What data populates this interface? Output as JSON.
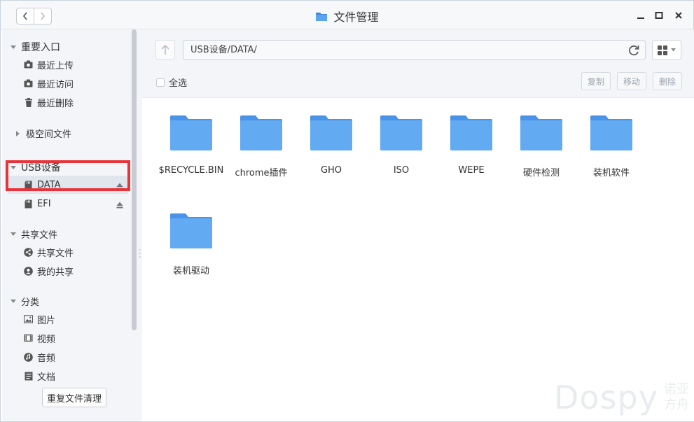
{
  "window": {
    "title": "文件管理"
  },
  "sidebar": {
    "sections": [
      {
        "label": "重要入口",
        "items": [
          {
            "label": "最近上传",
            "icon": "camera-icon"
          },
          {
            "label": "最近访问",
            "icon": "camera-icon"
          },
          {
            "label": "最近删除",
            "icon": "trash-icon"
          }
        ]
      },
      {
        "label": "极空间文件",
        "items": []
      },
      {
        "label": "USB设备",
        "items": [
          {
            "label": "DATA",
            "icon": "sd-card-icon",
            "selected": true
          },
          {
            "label": "EFI",
            "icon": "sd-card-icon"
          }
        ]
      },
      {
        "label": "共享文件",
        "items": [
          {
            "label": "共享文件",
            "icon": "share-icon"
          },
          {
            "label": "我的共享",
            "icon": "user-icon"
          }
        ]
      },
      {
        "label": "分类",
        "items": [
          {
            "label": "图片",
            "icon": "image-icon"
          },
          {
            "label": "视频",
            "icon": "film-icon"
          },
          {
            "label": "音频",
            "icon": "music-icon"
          },
          {
            "label": "文档",
            "icon": "document-icon"
          }
        ]
      }
    ],
    "clean_button": "重复文件清理"
  },
  "toolbar": {
    "path": "USB设备/DATA/",
    "select_all": "全选",
    "copy": "复制",
    "move": "移动",
    "delete": "删除"
  },
  "files": [
    {
      "name": "$RECYCLE.BIN"
    },
    {
      "name": "chrome插件"
    },
    {
      "name": "GHO"
    },
    {
      "name": "ISO"
    },
    {
      "name": "WEPE"
    },
    {
      "name": "硬件检测"
    },
    {
      "name": "装机软件"
    },
    {
      "name": "装机驱动"
    }
  ],
  "watermark": {
    "big": "Dospy",
    "small_line1": "诺亚",
    "small_line2": "方舟"
  },
  "colors": {
    "folder": "#5aa4f0",
    "folder_dark": "#4b93e6",
    "highlight": "#e8333a",
    "sidebar_bg": "#f3f5f8"
  }
}
